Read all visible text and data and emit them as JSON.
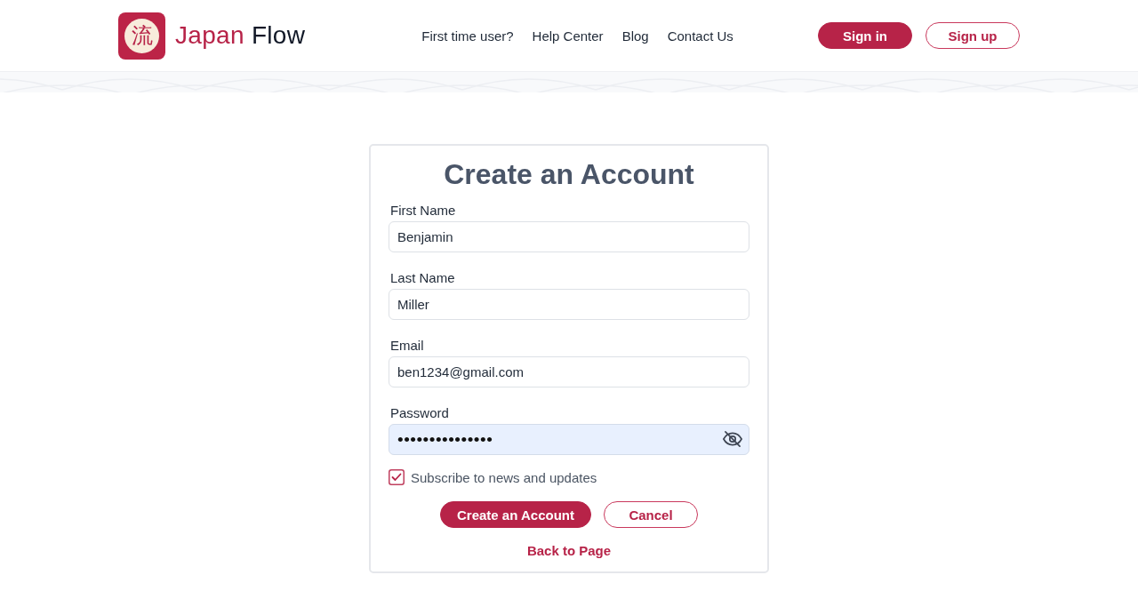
{
  "header": {
    "logo": {
      "glyph": "流",
      "words": [
        "Japan",
        "Flow"
      ]
    },
    "nav": [
      "First time user?",
      "Help Center",
      "Blog",
      "Contact Us"
    ],
    "buttons": [
      {
        "label": "Sign in",
        "kind": "filled"
      },
      {
        "label": "Sign up",
        "kind": "outline"
      }
    ]
  },
  "form": {
    "title": "Create an Account",
    "fields": [
      {
        "label": "First Name",
        "value": "Benjamin",
        "kind": "text",
        "autofilled": false
      },
      {
        "label": "Last Name",
        "value": "Miller",
        "kind": "text",
        "autofilled": false
      },
      {
        "label": "Email",
        "value": "ben1234@gmail.com",
        "kind": "text",
        "autofilled": false
      },
      {
        "label": "Password",
        "value": "•••••••••••••••",
        "kind": "password",
        "autofilled": true,
        "revealed": false
      }
    ],
    "subscribe": {
      "label": "Subscribe to news and updates",
      "checked": true
    },
    "buttons": [
      {
        "label": "Create an Account",
        "kind": "filled"
      },
      {
        "label": "Cancel",
        "kind": "outline"
      }
    ],
    "back_link": "Back to Page"
  }
}
